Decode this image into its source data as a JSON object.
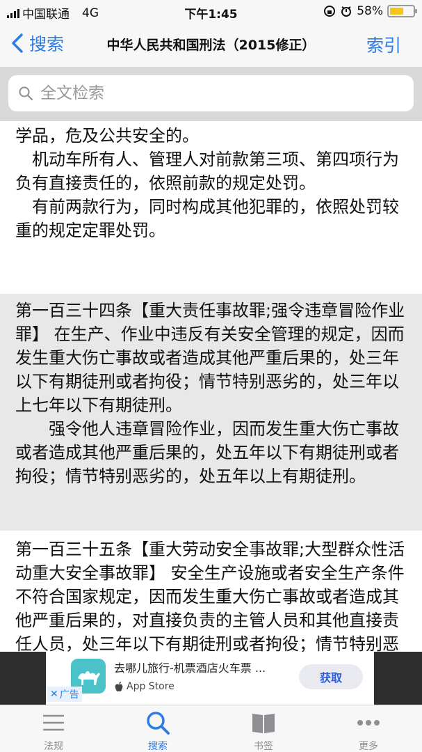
{
  "status_bar": {
    "carrier": "中国联通",
    "network": "4G",
    "time": "下午1:45",
    "battery_percent": "58%",
    "battery_level": 0.58
  },
  "nav": {
    "back_label": "搜索",
    "title": "中华人民共和国刑法（2015修正）",
    "index_label": "索引"
  },
  "search": {
    "placeholder": "全文检索"
  },
  "content": {
    "block1_lines": [
      "学品，危及公共安全的。",
      "机动车所有人、管理人对前款第三项、第四项行为负有直接责任的，依照前款的规定处罚。",
      "有前两款行为，同时构成其他犯罪的，依照处罚较重的规定定罪处罚。"
    ],
    "article134": {
      "heading": "第一百三十四条【重大责任事故罪;强令违章冒险作业罪】",
      "body": " 在生产、作业中违反有关安全管理的规定，因而发生重大伤亡事故或者造成其他严重后果的，处三年以下有期徒刑或者拘役；情节特别恶劣的，处三年以上七年以下有期徒刑。",
      "para2": "强令他人违章冒险作业，因而发生重大伤亡事故或者造成其他严重后果的，处五年以下有期徒刑或者拘役；情节特别恶劣的，处五年以上有期徒刑。"
    },
    "article135": {
      "heading": "第一百三十五条【重大劳动安全事故罪;大型群众性活动重大安全事故罪】",
      "body": " 安全生产设施或者安全生产条件不符合国家规定，因而发生重大伤亡事故或者造成其他严重后果的，对直接负责的主管人员和其他直接责任人员，处三年以下有期徒刑或者拘役；情节特别恶劣的，处三年以上七年以下有期徒刑。"
    }
  },
  "ad": {
    "title": "去哪儿旅行-机票酒店火车票 ...",
    "store": "App Store",
    "button": "获取",
    "badge": "广告"
  },
  "tabs": [
    {
      "label": "法规",
      "icon": "list-icon"
    },
    {
      "label": "搜索",
      "icon": "search-icon"
    },
    {
      "label": "书签",
      "icon": "book-icon"
    },
    {
      "label": "更多",
      "icon": "more-icon"
    }
  ],
  "colors": {
    "accent": "#2b7de9",
    "highlight_block": "#e8e8e8",
    "ad_bar": "#2e2e2e"
  }
}
